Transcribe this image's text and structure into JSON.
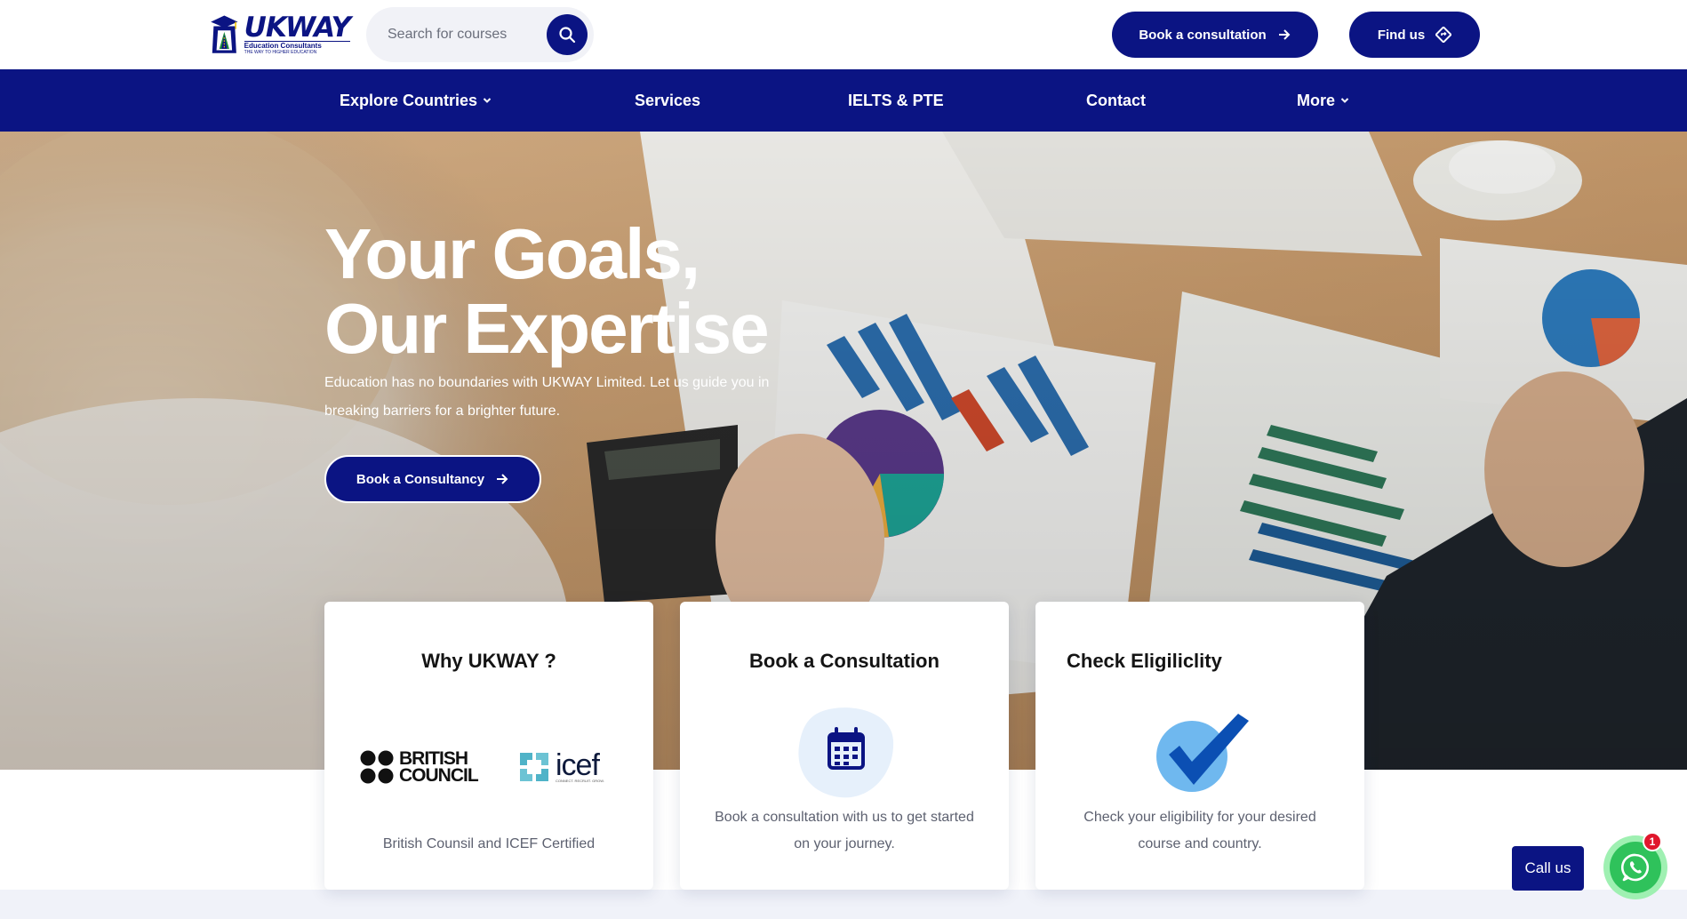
{
  "header": {
    "logo": {
      "name": "UKWAY",
      "subtitle": "Education Consultants",
      "tagline": "THE WAY TO HIGHER EDUCATION"
    },
    "search": {
      "placeholder": "Search for courses",
      "value": ""
    },
    "book_consultation_label": "Book a consultation",
    "find_us_label": "Find us"
  },
  "nav": {
    "items": [
      {
        "label": "Explore Countries",
        "has_dropdown": true
      },
      {
        "label": "Services",
        "has_dropdown": false
      },
      {
        "label": "IELTS & PTE",
        "has_dropdown": false
      },
      {
        "label": "Contact",
        "has_dropdown": false
      },
      {
        "label": "More",
        "has_dropdown": true
      }
    ]
  },
  "hero": {
    "title_line1": "Your Goals,",
    "title_line2": "Our Expertise",
    "description": "Education has no boundaries with UKWAY Limited. Let us guide you in breaking barriers for a brighter future.",
    "cta_label": "Book a Consultancy"
  },
  "cards": [
    {
      "title": "Why UKWAY ?",
      "logos": [
        {
          "text_line1": "BRITISH",
          "text_line2": "COUNCIL"
        },
        {
          "text": "icef",
          "tagline": "CONNECT. RECRUIT. GROW."
        }
      ],
      "text": "British Counsil and ICEF Certified"
    },
    {
      "title": "Book a Consultation",
      "icon": "calendar-icon",
      "text": "Book a consultation with us to get started on your journey."
    },
    {
      "title": "Check Eligiliclity",
      "icon": "checkmark-icon",
      "text": "Check your eligibility for your desired course and country."
    }
  ],
  "floating": {
    "call_us_label": "Call us",
    "whatsapp_badge": "1"
  },
  "colors": {
    "brand_navy": "#0b1483",
    "whatsapp_green": "#2fc25b",
    "badge_red": "#e0172c",
    "check_blue": "#0b4fb3",
    "check_circle": "#6fb8ef"
  }
}
